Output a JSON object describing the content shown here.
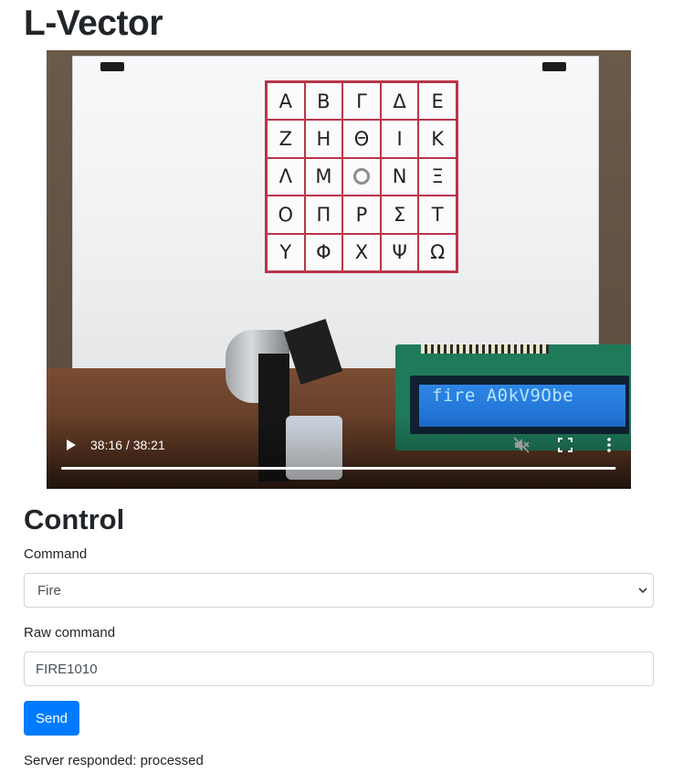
{
  "page": {
    "title": "L-Vector"
  },
  "video": {
    "time_display": "38:16 / 38:21",
    "progress_fraction": 0.998,
    "grid_letters": [
      [
        "Α",
        "Β",
        "Γ",
        "Δ",
        "Ε"
      ],
      [
        "Ζ",
        "Η",
        "Θ",
        "Ι",
        "Κ"
      ],
      [
        "Λ",
        "Μ",
        "",
        "Ν",
        "Ξ"
      ],
      [
        "Ο",
        "Π",
        "Ρ",
        "Σ",
        "Τ"
      ],
      [
        "Υ",
        "Φ",
        "Χ",
        "Ψ",
        "Ω"
      ]
    ],
    "lcd_text": "fire A0kV9Obe",
    "icons": {
      "play": "play-icon",
      "mute": "muted-speaker-icon",
      "fullscreen": "fullscreen-icon",
      "more": "more-vertical-icon"
    }
  },
  "control": {
    "heading": "Control",
    "command_label": "Command",
    "command_selected": "Fire",
    "raw_label": "Raw command",
    "raw_value": "FIRE1010",
    "send_label": "Send",
    "response_text": "Server responded: processed"
  },
  "colors": {
    "primary": "#007bff",
    "grid_border": "#b8364a",
    "lcd_background": "#1e6ed0"
  }
}
